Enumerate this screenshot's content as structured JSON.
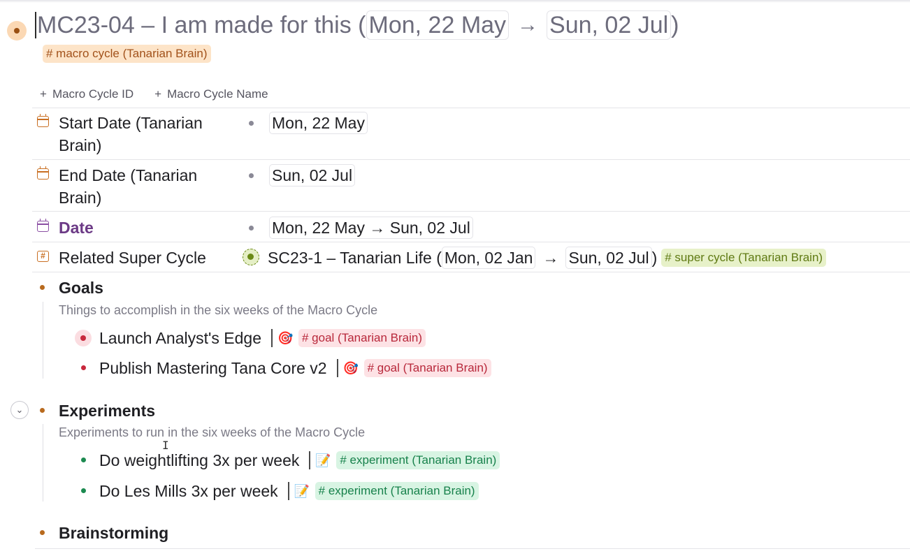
{
  "node": {
    "title_prefix": "MC23-04 – I am made for this (",
    "title_start": "Mon, 22 May",
    "title_arrow": "→",
    "title_end": "Sun, 02 Jul",
    "title_suffix": ")",
    "tag": "# macro cycle (Tanarian Brain)"
  },
  "add_fields": [
    {
      "plus": "+",
      "label": "Macro Cycle ID"
    },
    {
      "plus": "+",
      "label": "Macro Cycle Name"
    }
  ],
  "fields": {
    "start_date": {
      "name": "Start Date (Tanarian Brain)",
      "value": "Mon, 22 May"
    },
    "end_date": {
      "name": "End Date (Tanarian Brain)",
      "value": "Sun, 02 Jul"
    },
    "date": {
      "name": "Date",
      "value": "Mon, 22 May → Sun, 02 Jul"
    },
    "related_super_cycle": {
      "name": "Related Super Cycle",
      "ref_title": "SC23-1 – Tanarian Life (",
      "ref_start": "Mon, 02 Jan",
      "ref_arrow": "→",
      "ref_end": "Sun, 02 Jul",
      "ref_close": ")",
      "ref_tag": "# super cycle (Tanarian Brain)"
    }
  },
  "sections": {
    "goals": {
      "title": "Goals",
      "description": "Things to accomplish in the six weeks of the Macro Cycle",
      "items": [
        {
          "text": "Launch Analyst's Edge",
          "icon": "🎯",
          "tag": "# goal (Tanarian Brain)"
        },
        {
          "text": "Publish Mastering Tana Core v2",
          "icon": "🎯",
          "tag": "# goal (Tanarian Brain)"
        }
      ]
    },
    "experiments": {
      "title": "Experiments",
      "description": "Experiments to run in the six weeks of the Macro Cycle",
      "items": [
        {
          "text": "Do weightlifting 3x per week",
          "icon": "📝",
          "tag": "# experiment (Tanarian Brain)"
        },
        {
          "text": "Do Les Mills 3x per week",
          "icon": "📝",
          "tag": "# experiment (Tanarian Brain)"
        }
      ]
    },
    "brainstorming": {
      "title": "Brainstorming"
    }
  },
  "ui": {
    "collapse_icon": "⌄",
    "cursor_icon": "I"
  },
  "colors": {
    "macro_tag_bg": "#fde4c8",
    "super_tag_bg": "#e7f1c9",
    "goal_tag_bg": "#fde2e5",
    "experiment_tag_bg": "#d8f4e3",
    "date_field_color": "#6c3a86"
  }
}
